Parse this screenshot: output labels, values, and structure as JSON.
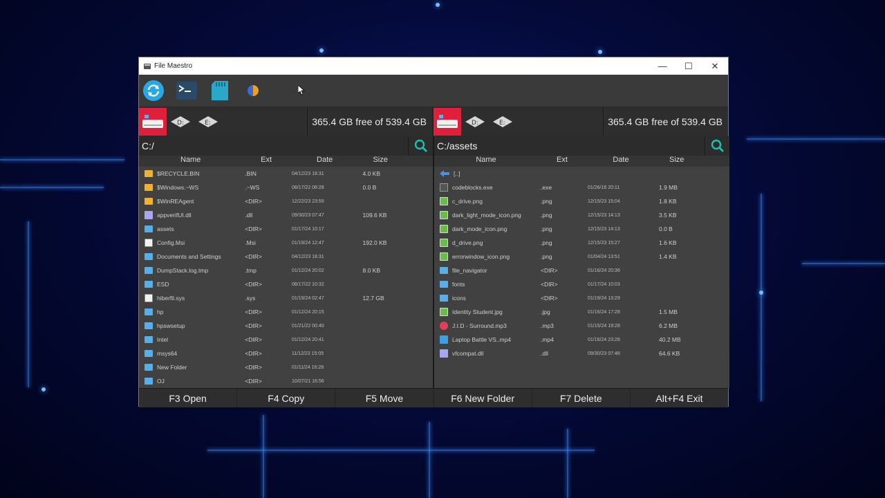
{
  "window": {
    "title": "File Maestro",
    "minimize": "—",
    "maximize": "☐",
    "close": "✕"
  },
  "toolbar": {
    "tools": [
      {
        "name": "refresh-icon"
      },
      {
        "name": "terminal-icon"
      },
      {
        "name": "sd-card-icon"
      },
      {
        "name": "theme-toggle-icon"
      }
    ]
  },
  "left": {
    "drives": [
      "C",
      "D",
      "E"
    ],
    "free_space": "365.4 GB free of 539.4 GB",
    "path": "C:/",
    "headers": {
      "name": "Name",
      "ext": "Ext",
      "date": "Date",
      "size": "Size"
    },
    "files": [
      {
        "icon": "folder-sys",
        "name": "$RECYCLE.BIN",
        "ext": ".BIN",
        "date": "04/12/23 18:31",
        "size": "4.0 KB"
      },
      {
        "icon": "folder-sys",
        "name": "$Windows.~WS",
        "ext": ".~WS",
        "date": "08/17/22 08:28",
        "size": "0.0 B"
      },
      {
        "icon": "folder-sys",
        "name": "$WinREAgent",
        "ext": "<DIR>",
        "date": "12/22/23 23:59",
        "size": ""
      },
      {
        "icon": "dll",
        "name": "appverifUI.dll",
        "ext": ".dll",
        "date": "09/30/23 07:47",
        "size": "109.6 KB"
      },
      {
        "icon": "folder",
        "name": "assets",
        "ext": "<DIR>",
        "date": "01/17/24 10:17",
        "size": ""
      },
      {
        "icon": "doc",
        "name": "Config.Msi",
        "ext": ".Msi",
        "date": "01/19/24 12:47",
        "size": "192.0 KB"
      },
      {
        "icon": "folder",
        "name": "Documents and Settings",
        "ext": "<DIR>",
        "date": "04/12/23 18:31",
        "size": ""
      },
      {
        "icon": "folder",
        "name": "DumpStack.log.tmp",
        "ext": ".tmp",
        "date": "01/12/24 20:02",
        "size": "8.0 KB"
      },
      {
        "icon": "folder",
        "name": "ESD",
        "ext": "<DIR>",
        "date": "08/17/22 10:32",
        "size": ""
      },
      {
        "icon": "doc",
        "name": "hiberfil.sys",
        "ext": ".sys",
        "date": "01/19/24 02:47",
        "size": "12.7 GB"
      },
      {
        "icon": "folder",
        "name": "hp",
        "ext": "<DIR>",
        "date": "01/12/24 20:15",
        "size": ""
      },
      {
        "icon": "folder",
        "name": "hpswsetup",
        "ext": "<DIR>",
        "date": "01/21/22 00:40",
        "size": ""
      },
      {
        "icon": "folder",
        "name": "Intel",
        "ext": "<DIR>",
        "date": "01/12/24 20:41",
        "size": ""
      },
      {
        "icon": "folder",
        "name": "msys64",
        "ext": "<DIR>",
        "date": "11/12/23 15:05",
        "size": ""
      },
      {
        "icon": "folder",
        "name": "New Folder",
        "ext": "<DIR>",
        "date": "01/11/24 16:28",
        "size": ""
      },
      {
        "icon": "folder",
        "name": "OJ",
        "ext": "<DIR>",
        "date": "10/07/21 16:56",
        "size": ""
      }
    ]
  },
  "right": {
    "drives": [
      "C",
      "D",
      "E"
    ],
    "free_space": "365.4 GB free of 539.4 GB",
    "path": "C:/assets",
    "headers": {
      "name": "Name",
      "ext": "Ext",
      "date": "Date",
      "size": "Size"
    },
    "files": [
      {
        "icon": "up",
        "name": "[..]",
        "ext": "",
        "date": "",
        "size": ""
      },
      {
        "icon": "exe",
        "name": "codeblocks.exe",
        "ext": ".exe",
        "date": "01/26/16 20:11",
        "size": "1.9 MB"
      },
      {
        "icon": "png",
        "name": "c_drive.png",
        "ext": ".png",
        "date": "12/15/23 15:04",
        "size": "1.8 KB"
      },
      {
        "icon": "png",
        "name": "dark_light_mode_icon.png",
        "ext": ".png",
        "date": "12/15/23 14:13",
        "size": "3.5 KB"
      },
      {
        "icon": "png",
        "name": "dark_mode_icon.png",
        "ext": ".png",
        "date": "12/15/23 14:13",
        "size": "0.0 B"
      },
      {
        "icon": "png",
        "name": "d_drive.png",
        "ext": ".png",
        "date": "12/15/23 15:27",
        "size": "1.6 KB"
      },
      {
        "icon": "png",
        "name": "errorwindow_icon.png",
        "ext": ".png",
        "date": "01/04/24 13:51",
        "size": "1.4 KB"
      },
      {
        "icon": "folder",
        "name": "file_navigator",
        "ext": "<DIR>",
        "date": "01/16/24 20:36",
        "size": ""
      },
      {
        "icon": "folder",
        "name": "fonts",
        "ext": "<DIR>",
        "date": "01/17/24 10:03",
        "size": ""
      },
      {
        "icon": "folder",
        "name": "icons",
        "ext": "<DIR>",
        "date": "01/19/24 13:29",
        "size": ""
      },
      {
        "icon": "png",
        "name": "Identity Student.jpg",
        "ext": ".jpg",
        "date": "01/16/24 17:28",
        "size": "1.5 MB"
      },
      {
        "icon": "mp3",
        "name": "J.I.D - Surround.mp3",
        "ext": ".mp3",
        "date": "01/15/24 19:28",
        "size": "6.2 MB"
      },
      {
        "icon": "mp4",
        "name": "Laptop Battle VS..mp4",
        "ext": ".mp4",
        "date": "01/16/24 23:28",
        "size": "40.2 MB"
      },
      {
        "icon": "dll",
        "name": "vfcompat.dll",
        "ext": ".dll",
        "date": "09/30/23 07:48",
        "size": "64.6 KB"
      }
    ]
  },
  "fnkeys": {
    "open": "F3 Open",
    "copy": "F4 Copy",
    "move": "F5 Move",
    "new_folder": "F6 New Folder",
    "delete": "F7 Delete",
    "exit": "Alt+F4 Exit"
  },
  "colors": {
    "accent_drive": "#e0203a",
    "search_icon": "#19c0b0",
    "refresh_icon": "#29a8e8"
  }
}
